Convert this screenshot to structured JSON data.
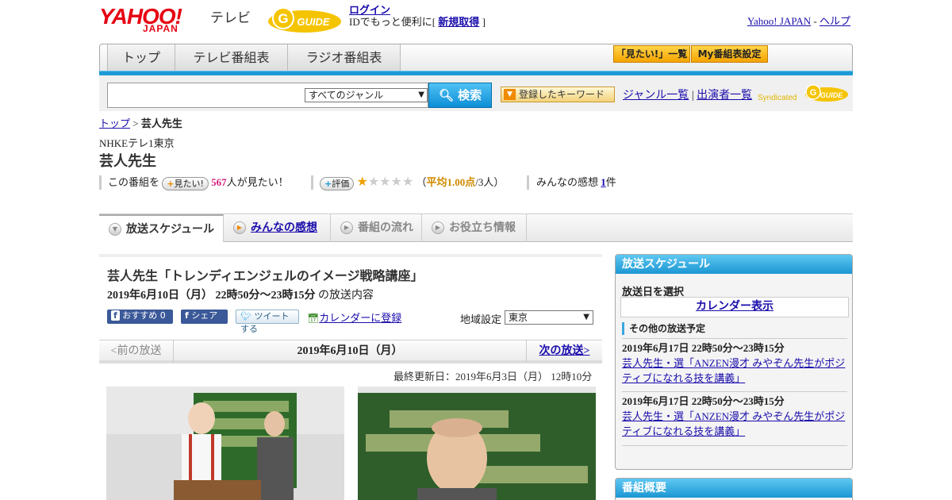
{
  "header": {
    "yahoo_logo": "YAHOO!",
    "yahoo_sub": "JAPAN",
    "tv_label": "テレビ",
    "gguide_logo": "G GUIDE",
    "login_link": "ログイン",
    "login_text_before": "IDでもっと便利に[",
    "signup_link": "新規取得",
    "login_text_after": "]",
    "yahoo_japan_link": "Yahoo! JAPAN",
    "help_sep": "-",
    "help_link": "ヘルプ"
  },
  "nav": {
    "tabs": [
      "トップ",
      "テレビ番組表",
      "ラジオ番組表"
    ],
    "mitai_list": "「見たい!」一覧",
    "my_schedule": "My番組表設定"
  },
  "search": {
    "input_value": "",
    "genre_selected": "すべてのジャンル",
    "button_label": "検索",
    "keyword_button": "登録したキーワード",
    "genre_list_link": "ジャンル一覧",
    "links_sep": "|",
    "performer_link": "出演者一覧",
    "syndicated_label": "Syndicated"
  },
  "breadcrumb": {
    "top": "トップ",
    "sep": ">",
    "current": "芸人先生"
  },
  "program": {
    "channel": "NHKEテレ1東京",
    "title": "芸人先生",
    "stats": {
      "mitai_prefix": "この番組を",
      "mitai_badge": "見たい!",
      "mitai_count": "567",
      "mitai_suffix": "人が見たい！",
      "rating_badge": "評価",
      "rating_value": 1,
      "rating_max": 5,
      "rating_open": "（",
      "rating_avg": "平均1.00点",
      "rating_count": "/3人）",
      "impressions_prefix": "みんなの感想",
      "impressions_count": "1",
      "impressions_suffix": "件"
    }
  },
  "tabs": {
    "schedule": "放送スケジュール",
    "impressions": "みんなの感想",
    "flow": "番組の流れ",
    "info": "お役立ち情報"
  },
  "episode": {
    "title": "芸人先生「トレンディエンジェルのイメージ戦略講座」",
    "datetime": "2019年6月10日（月） 22時50分～23時15分",
    "datetime_suffix": "の放送内容",
    "recommend": "おすすめ 0",
    "share": "シェア",
    "tweet": "ツイートする",
    "calendar": "カレンダーに登録",
    "region_label": "地域設定",
    "region_selected": "東京",
    "prev": "<前の放送",
    "current_date": "2019年6月10日（月）",
    "next": "次の放送>",
    "updated": "最終更新日：2019年6月3日（月） 12時10分"
  },
  "sidebar": {
    "schedule_title": "放送スケジュール",
    "select_label": "放送日を選択",
    "calendar_link": "カレンダー表示",
    "other_label": "その他の放送予定",
    "items": [
      {
        "datetime": "2019年6月17日 22時50分～23時15分",
        "title": "芸人先生・選「ANZEN漫才 みやぞん先生がポジティブになれる技を講義」"
      },
      {
        "datetime": "2019年6月17日 22時50分～23時15分",
        "title": "芸人先生・選「ANZEN漫才 みやぞん先生がポジティブになれる技を講義」"
      }
    ],
    "summary_title": "番組概要"
  },
  "colors": {
    "accent_blue": "#1e9ad6",
    "yahoo_red": "#e60012",
    "gguide_yellow": "#f5c400",
    "pink": "#d6207d"
  }
}
